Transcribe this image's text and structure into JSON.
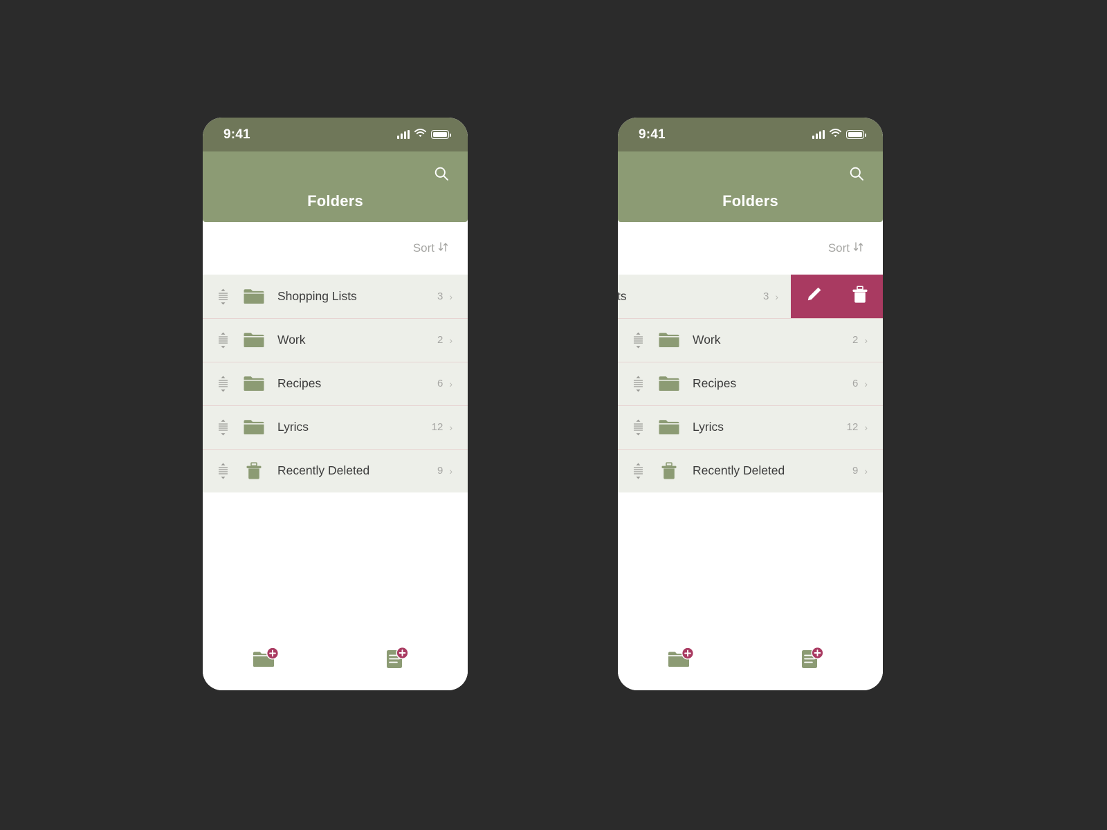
{
  "meta": {
    "background_color": "#2b2b2b",
    "accent_green": "#8c9b74",
    "status_bar_green": "#6f7759",
    "accent_magenta": "#a93a61",
    "row_background": "#edefe9",
    "divider_color": "#e7d4d2"
  },
  "status_bar": {
    "time": "9:41",
    "signal_icon": "cellular-signal-icon",
    "wifi_icon": "wifi-icon",
    "battery_icon": "battery-icon"
  },
  "header": {
    "title": "Folders",
    "search_icon": "search-icon"
  },
  "sort": {
    "label": "Sort",
    "icon": "sort-arrows-icon"
  },
  "folders": [
    {
      "name": "Shopping Lists",
      "count": "3",
      "icon": "folder-icon",
      "chevron": "›"
    },
    {
      "name": "Work",
      "count": "2",
      "icon": "folder-icon",
      "chevron": "›"
    },
    {
      "name": "Recipes",
      "count": "6",
      "icon": "folder-icon",
      "chevron": "›"
    },
    {
      "name": "Lyrics",
      "count": "12",
      "icon": "folder-icon",
      "chevron": "›"
    },
    {
      "name": "Recently Deleted",
      "count": "9",
      "icon": "trash-icon",
      "chevron": "›"
    }
  ],
  "swiped_row": {
    "visible_name": "pping Lists",
    "count": "3",
    "chevron": "›",
    "edit_icon": "pencil-icon",
    "delete_icon": "trash-icon"
  },
  "toolbar": {
    "new_folder_icon": "new-folder-icon",
    "new_note_icon": "new-note-icon",
    "badge_glyph": "+"
  }
}
